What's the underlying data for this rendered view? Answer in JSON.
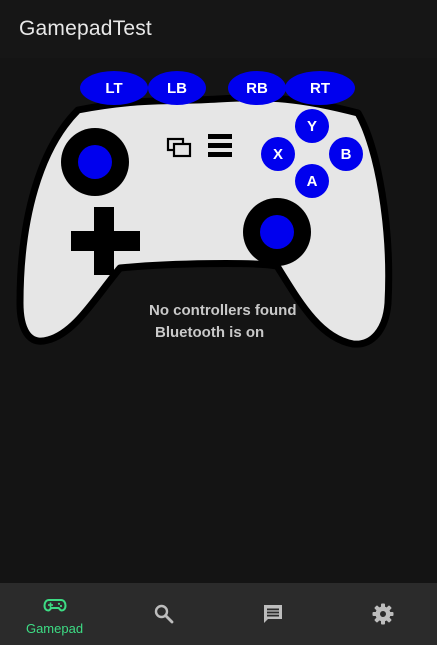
{
  "app": {
    "title": "GamepadTest"
  },
  "gamepad": {
    "buttons": {
      "lt": "LT",
      "lb": "LB",
      "rb": "RB",
      "rt": "RT",
      "y": "Y",
      "x": "X",
      "b": "B",
      "a": "A"
    }
  },
  "status": {
    "line1": "No controllers found",
    "line2": "Bluetooth is on"
  },
  "bottom_nav": {
    "items": [
      {
        "id": "gamepad",
        "label": "Gamepad",
        "icon": "gamepad-icon",
        "active": true
      },
      {
        "id": "search",
        "label": "",
        "icon": "search-icon",
        "active": false
      },
      {
        "id": "chat",
        "label": "",
        "icon": "chat-icon",
        "active": false
      },
      {
        "id": "settings",
        "label": "",
        "icon": "gear-icon",
        "active": false
      }
    ]
  },
  "colors": {
    "background": "#141414",
    "controller_body": "#e6e6e6",
    "controller_outline": "#000000",
    "button_blue": "#0000ee",
    "nav_background": "#2b2b2b",
    "nav_active": "#3ddc84",
    "nav_inactive": "#bdbdbd"
  }
}
